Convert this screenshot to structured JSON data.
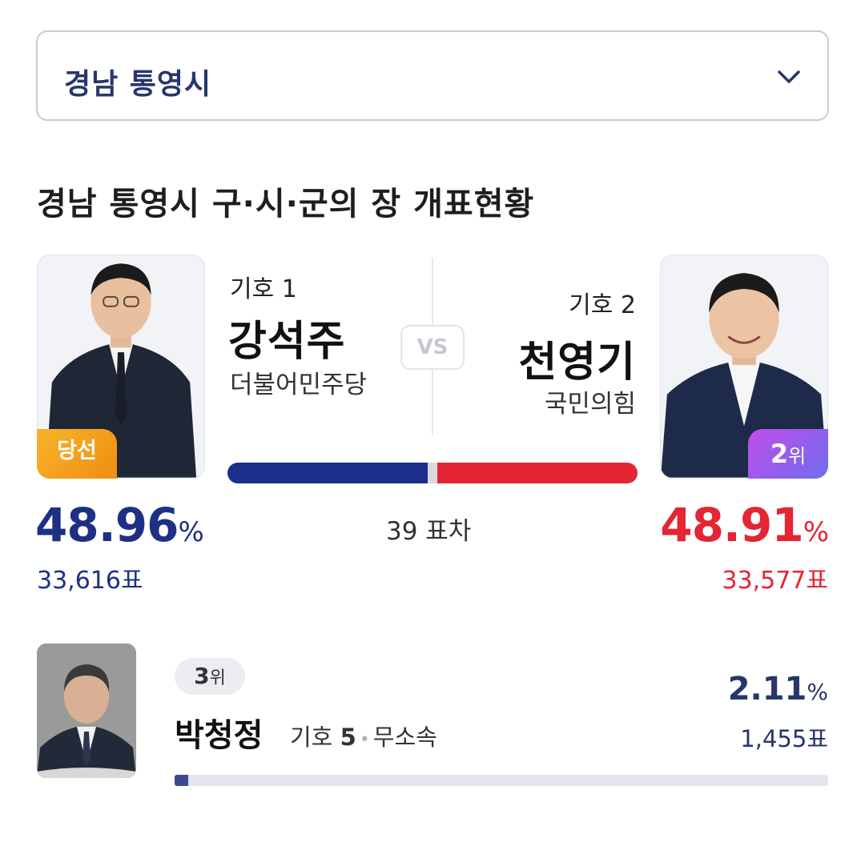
{
  "region_select": {
    "value": "경남 통영시"
  },
  "section_title": "경남 통영시 구·시·군의 장 개표현황",
  "vs_label": "VS",
  "margin_text": "39 표차",
  "colors": {
    "party1": "#1a2f8a",
    "party2": "#e32534",
    "winner_badge": "#f7b42a",
    "second_badge": "#9b5ded",
    "navy": "#27366b"
  },
  "candidates": [
    {
      "number_label": "기호 1",
      "name": "강석주",
      "party": "더불어민주당",
      "badge": "당선",
      "percent": "48.96",
      "percent_unit": "%",
      "votes": "33,616표",
      "share": 48.96
    },
    {
      "number_label": "기호 2",
      "name": "천영기",
      "party": "국민의힘",
      "badge_num": "2",
      "badge_suffix": "위",
      "percent": "48.91",
      "percent_unit": "%",
      "votes": "33,577표",
      "share": 48.91
    },
    {
      "rank_num": "3",
      "rank_suffix": "위",
      "name": "박청정",
      "number_prefix": "기호",
      "number": "5",
      "separator": "•",
      "party": "무소속",
      "percent": "2.11",
      "percent_unit": "%",
      "votes": "1,455표",
      "share": 2.11
    }
  ]
}
